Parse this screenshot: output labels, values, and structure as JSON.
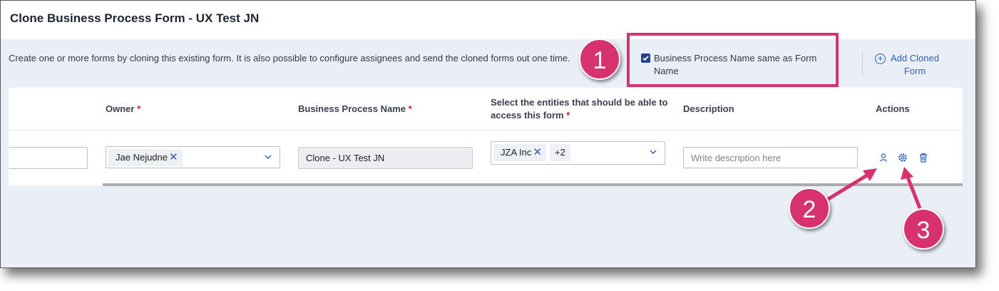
{
  "dialog": {
    "title": "Clone Business Process Form - UX Test JN",
    "intro": "Create one or more forms by cloning this existing form. It is also possible to configure assignees and send the cloned forms out one time.",
    "checkbox_label": "Business Process Name same as Form Name",
    "checkbox_checked": true,
    "add_cloned_label": "Add Cloned Form"
  },
  "table": {
    "headers": {
      "owner": "Owner",
      "process_name": "Business Process Name",
      "entities": "Select the entities that should be able to access this form",
      "description": "Description",
      "actions": "Actions"
    },
    "required_marker": "*",
    "row": {
      "owner_chip": "Jae Nejudne",
      "process_name_value": "Clone - UX Test JN",
      "entity_chip": "JZA Inc",
      "entity_more": "+2",
      "description_placeholder": "Write description here"
    }
  },
  "annotations": {
    "badge_1": "1",
    "badge_2": "2",
    "badge_3": "3",
    "color": "#d7326e"
  },
  "icons": [
    "check-icon",
    "add-circle-icon",
    "close-icon",
    "chevron-down-icon",
    "user-icon",
    "gear-icon",
    "trash-icon"
  ]
}
